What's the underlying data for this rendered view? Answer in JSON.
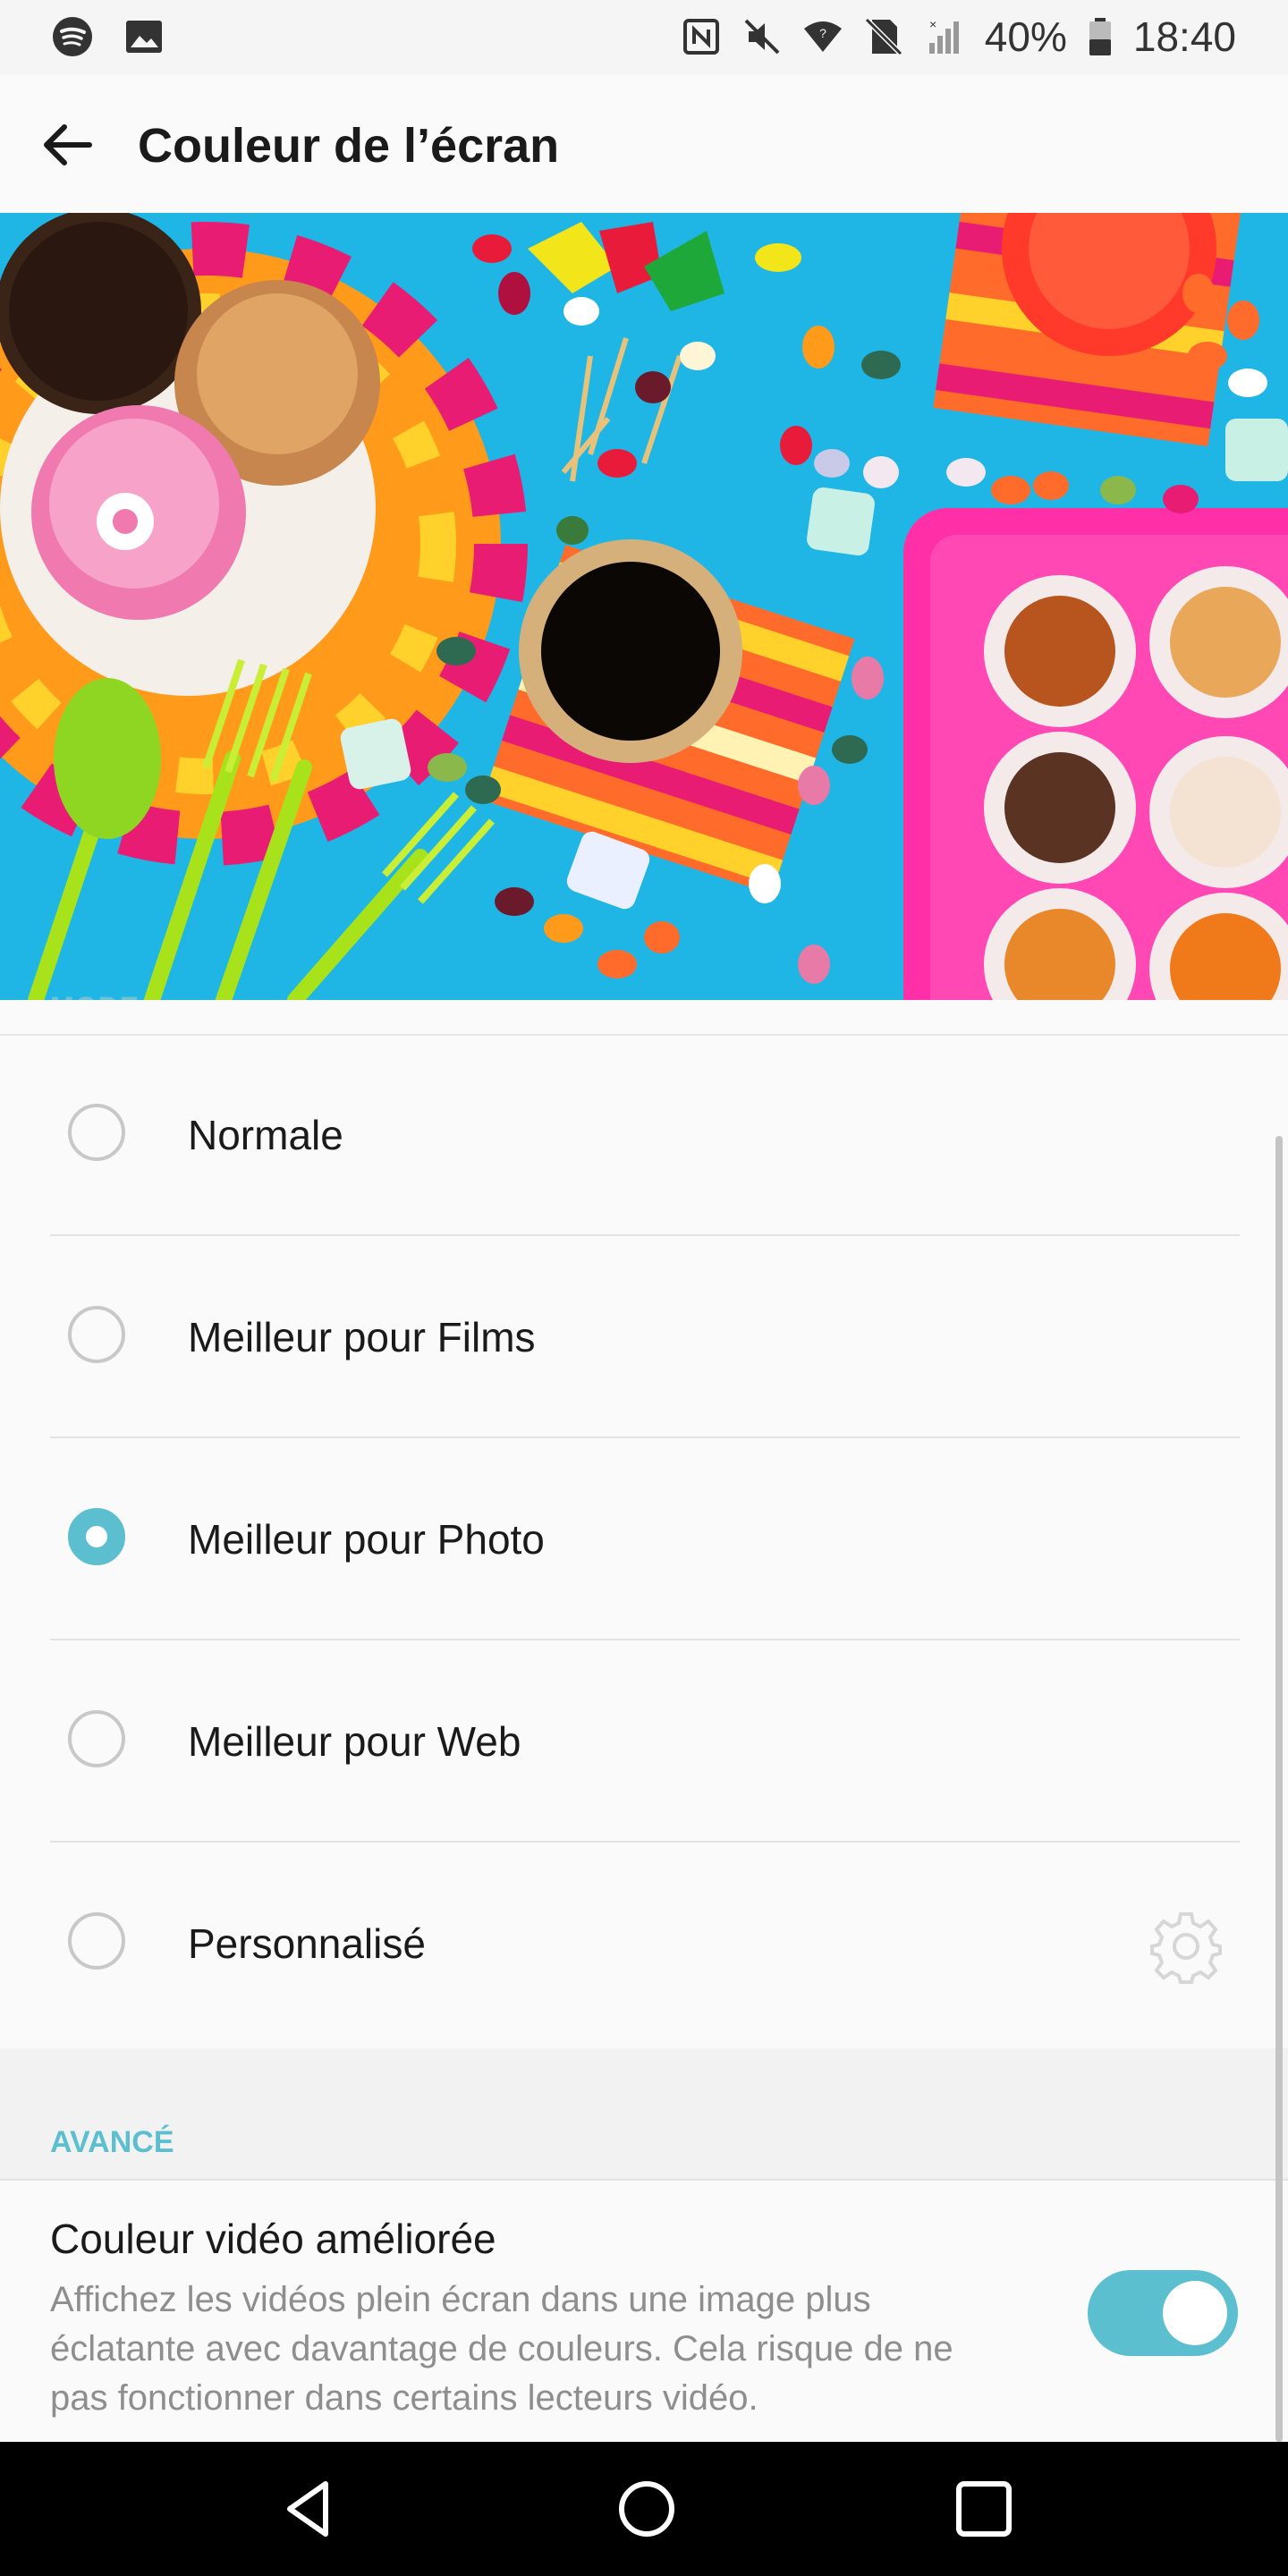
{
  "status_bar": {
    "battery": "40%",
    "time": "18:40",
    "icons_left": [
      "spotify-icon",
      "image-icon"
    ],
    "icons_right": [
      "nfc-icon",
      "mute-icon",
      "wifi-icon",
      "no-sim-icon",
      "signal-icon",
      "battery-icon"
    ]
  },
  "app_bar": {
    "title": "Couleur de l’écran"
  },
  "mode_section": {
    "label": "MODE",
    "options": [
      {
        "label": "Normale",
        "checked": false
      },
      {
        "label": "Meilleur pour Films",
        "checked": false
      },
      {
        "label": "Meilleur pour Photo",
        "checked": true
      },
      {
        "label": "Meilleur pour Web",
        "checked": false
      },
      {
        "label": "Personnalisé",
        "checked": false,
        "has_settings": true
      }
    ]
  },
  "advanced_section": {
    "label": "AVANCÉ",
    "setting": {
      "title": "Couleur vidéo améliorée",
      "description": "Affichez les vidéos plein écran dans une image plus éclatante avec davantage de couleurs. Cela risque de ne pas fonctionner dans certains lecteurs vidéo.",
      "enabled": true
    }
  },
  "colors": {
    "accent": "#5cbfcf",
    "hero_background": "#1fb6e6"
  }
}
